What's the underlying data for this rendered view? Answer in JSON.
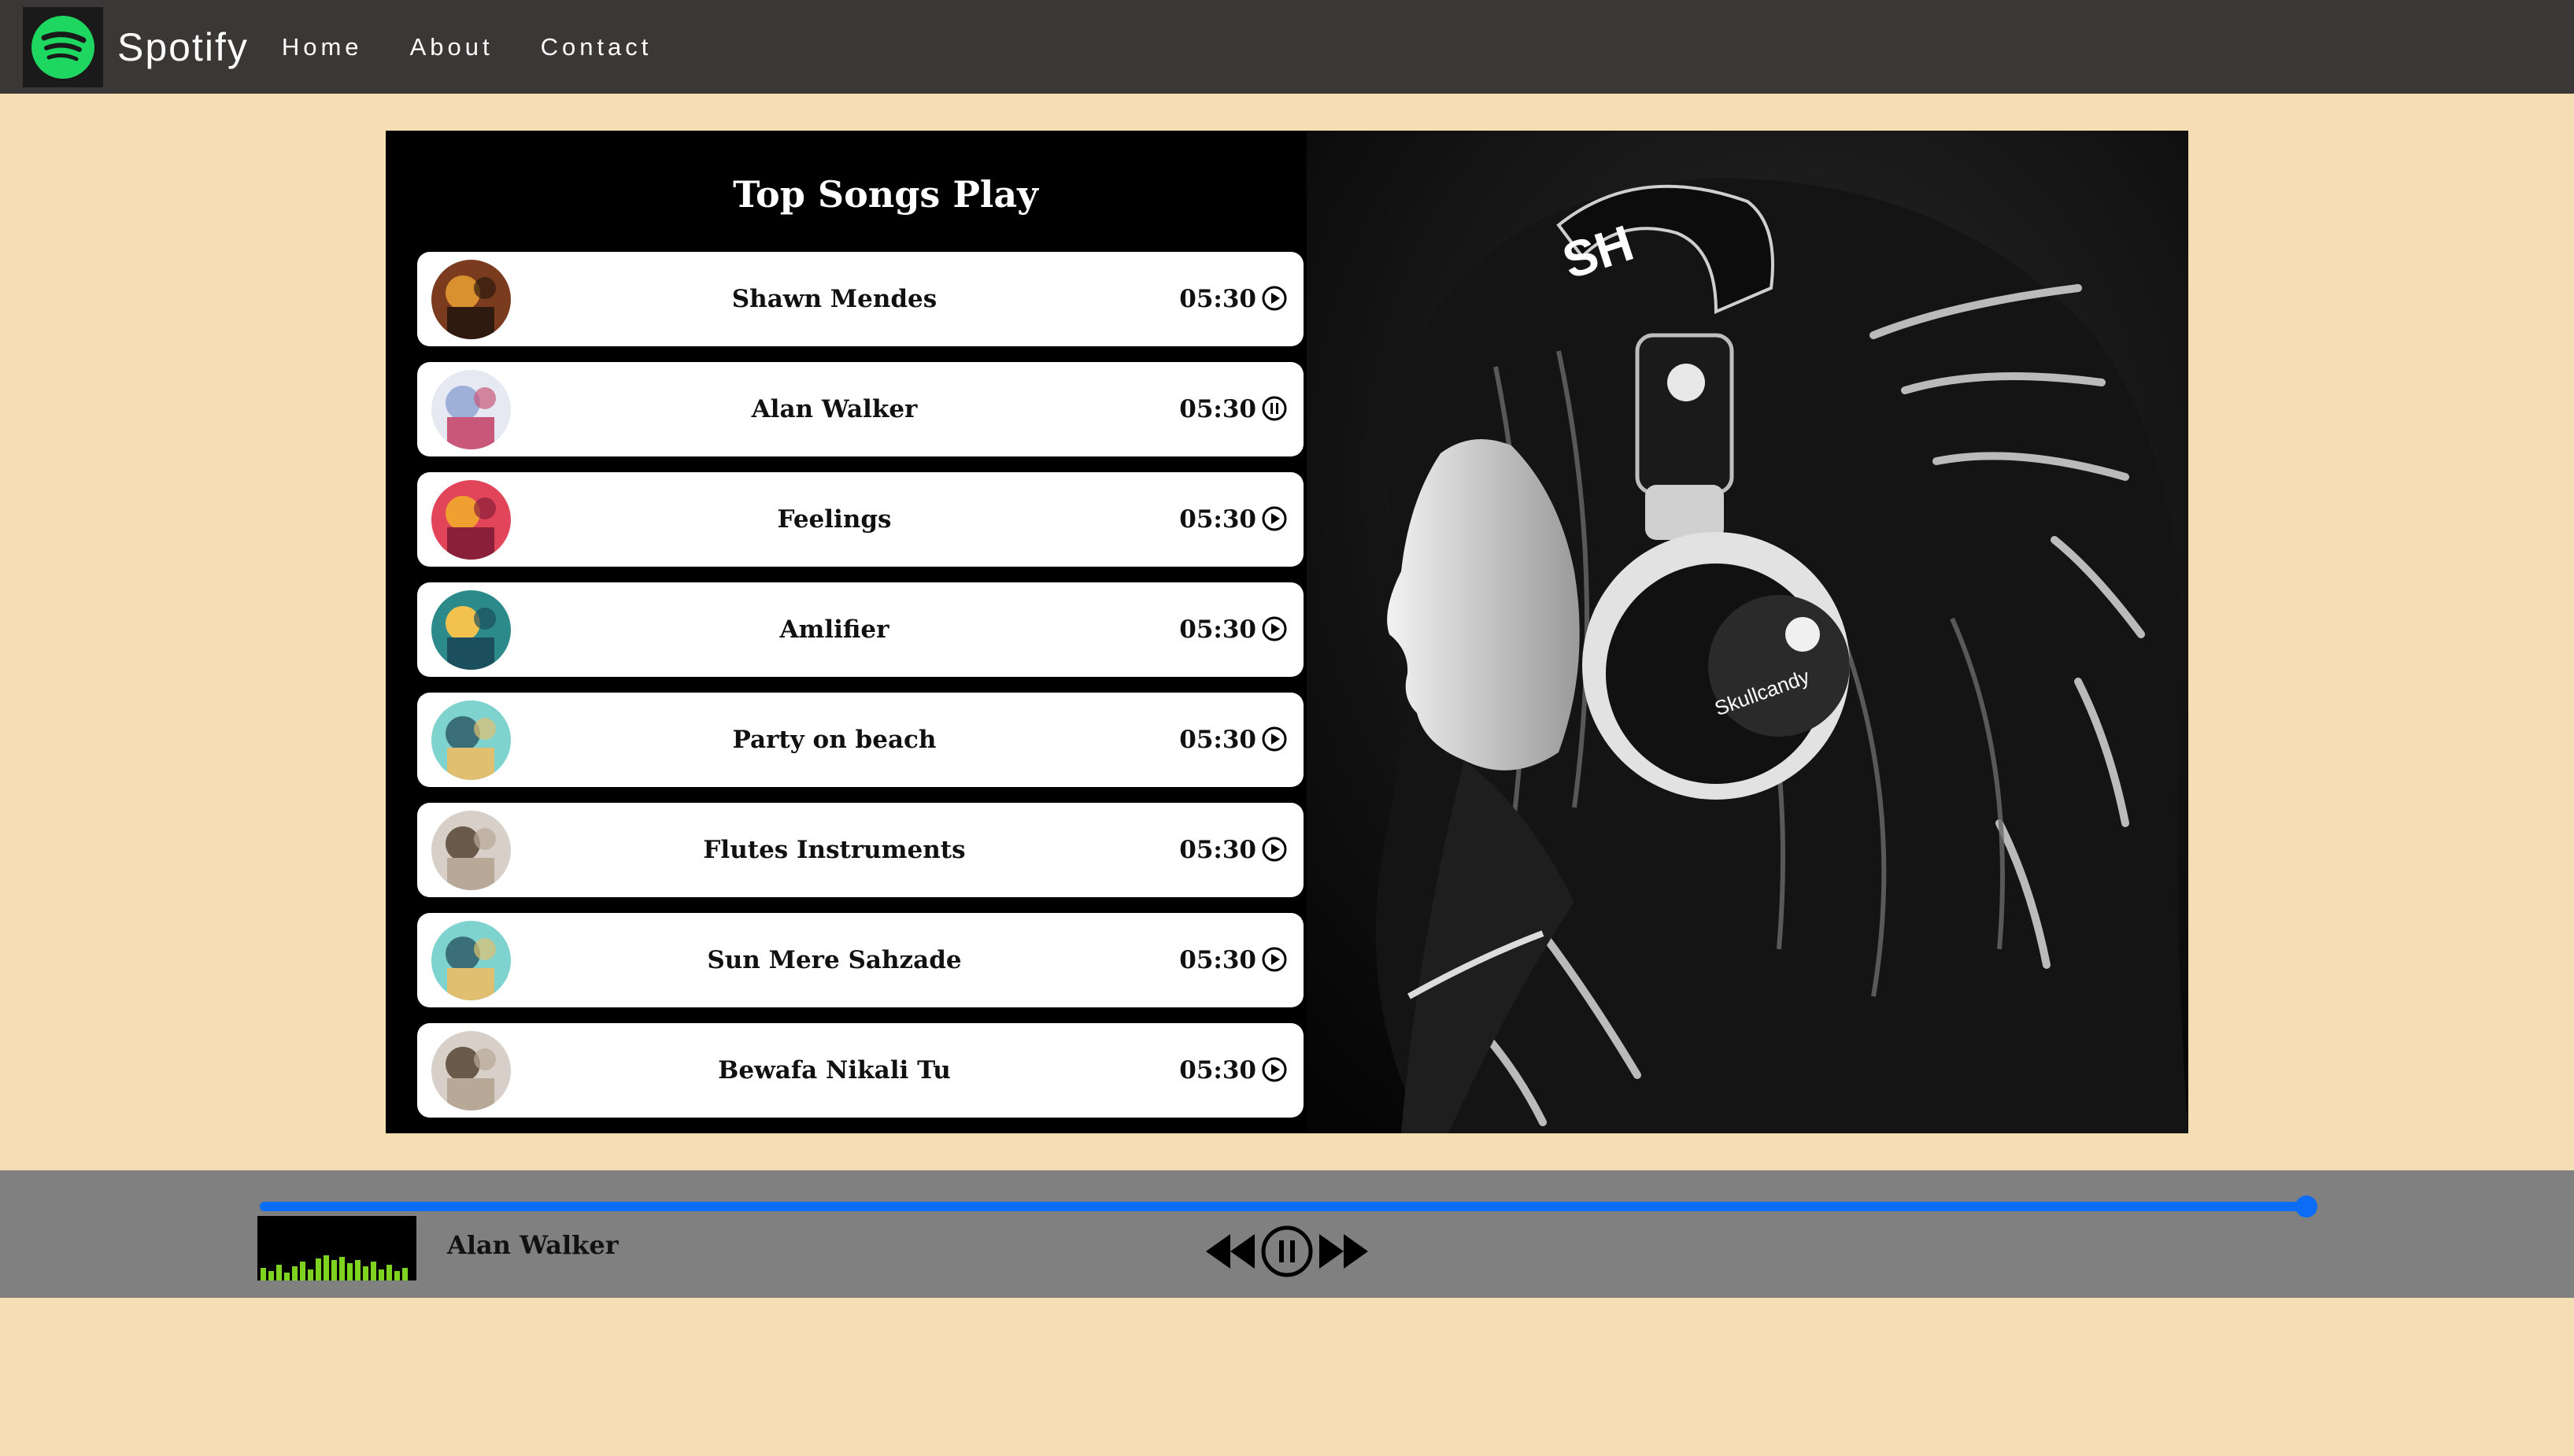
{
  "navbar": {
    "brand": "Spotify",
    "links": [
      "Home",
      "About",
      "Contact"
    ]
  },
  "song_list": {
    "title": "Top Songs Play",
    "songs": [
      {
        "name": "Shawn Mendes",
        "duration": "05:30",
        "state": "play"
      },
      {
        "name": "Alan Walker",
        "duration": "05:30",
        "state": "pause"
      },
      {
        "name": "Feelings",
        "duration": "05:30",
        "state": "play"
      },
      {
        "name": "Amlifier",
        "duration": "05:30",
        "state": "play"
      },
      {
        "name": "Party on beach",
        "duration": "05:30",
        "state": "play"
      },
      {
        "name": "Flutes Instruments",
        "duration": "05:30",
        "state": "play"
      },
      {
        "name": "Sun Mere Sahzade",
        "duration": "05:30",
        "state": "play"
      },
      {
        "name": "Bewafa Nikali Tu",
        "duration": "05:30",
        "state": "play"
      }
    ]
  },
  "player": {
    "now_playing": "Alan Walker",
    "progress": 1.0
  },
  "colors": {
    "page_bg": "#f5deb3",
    "navbar_bg": "#3a3736",
    "player_bg": "#808080",
    "accent": "#0b6cf6",
    "spotify_green": "#1ed760"
  }
}
